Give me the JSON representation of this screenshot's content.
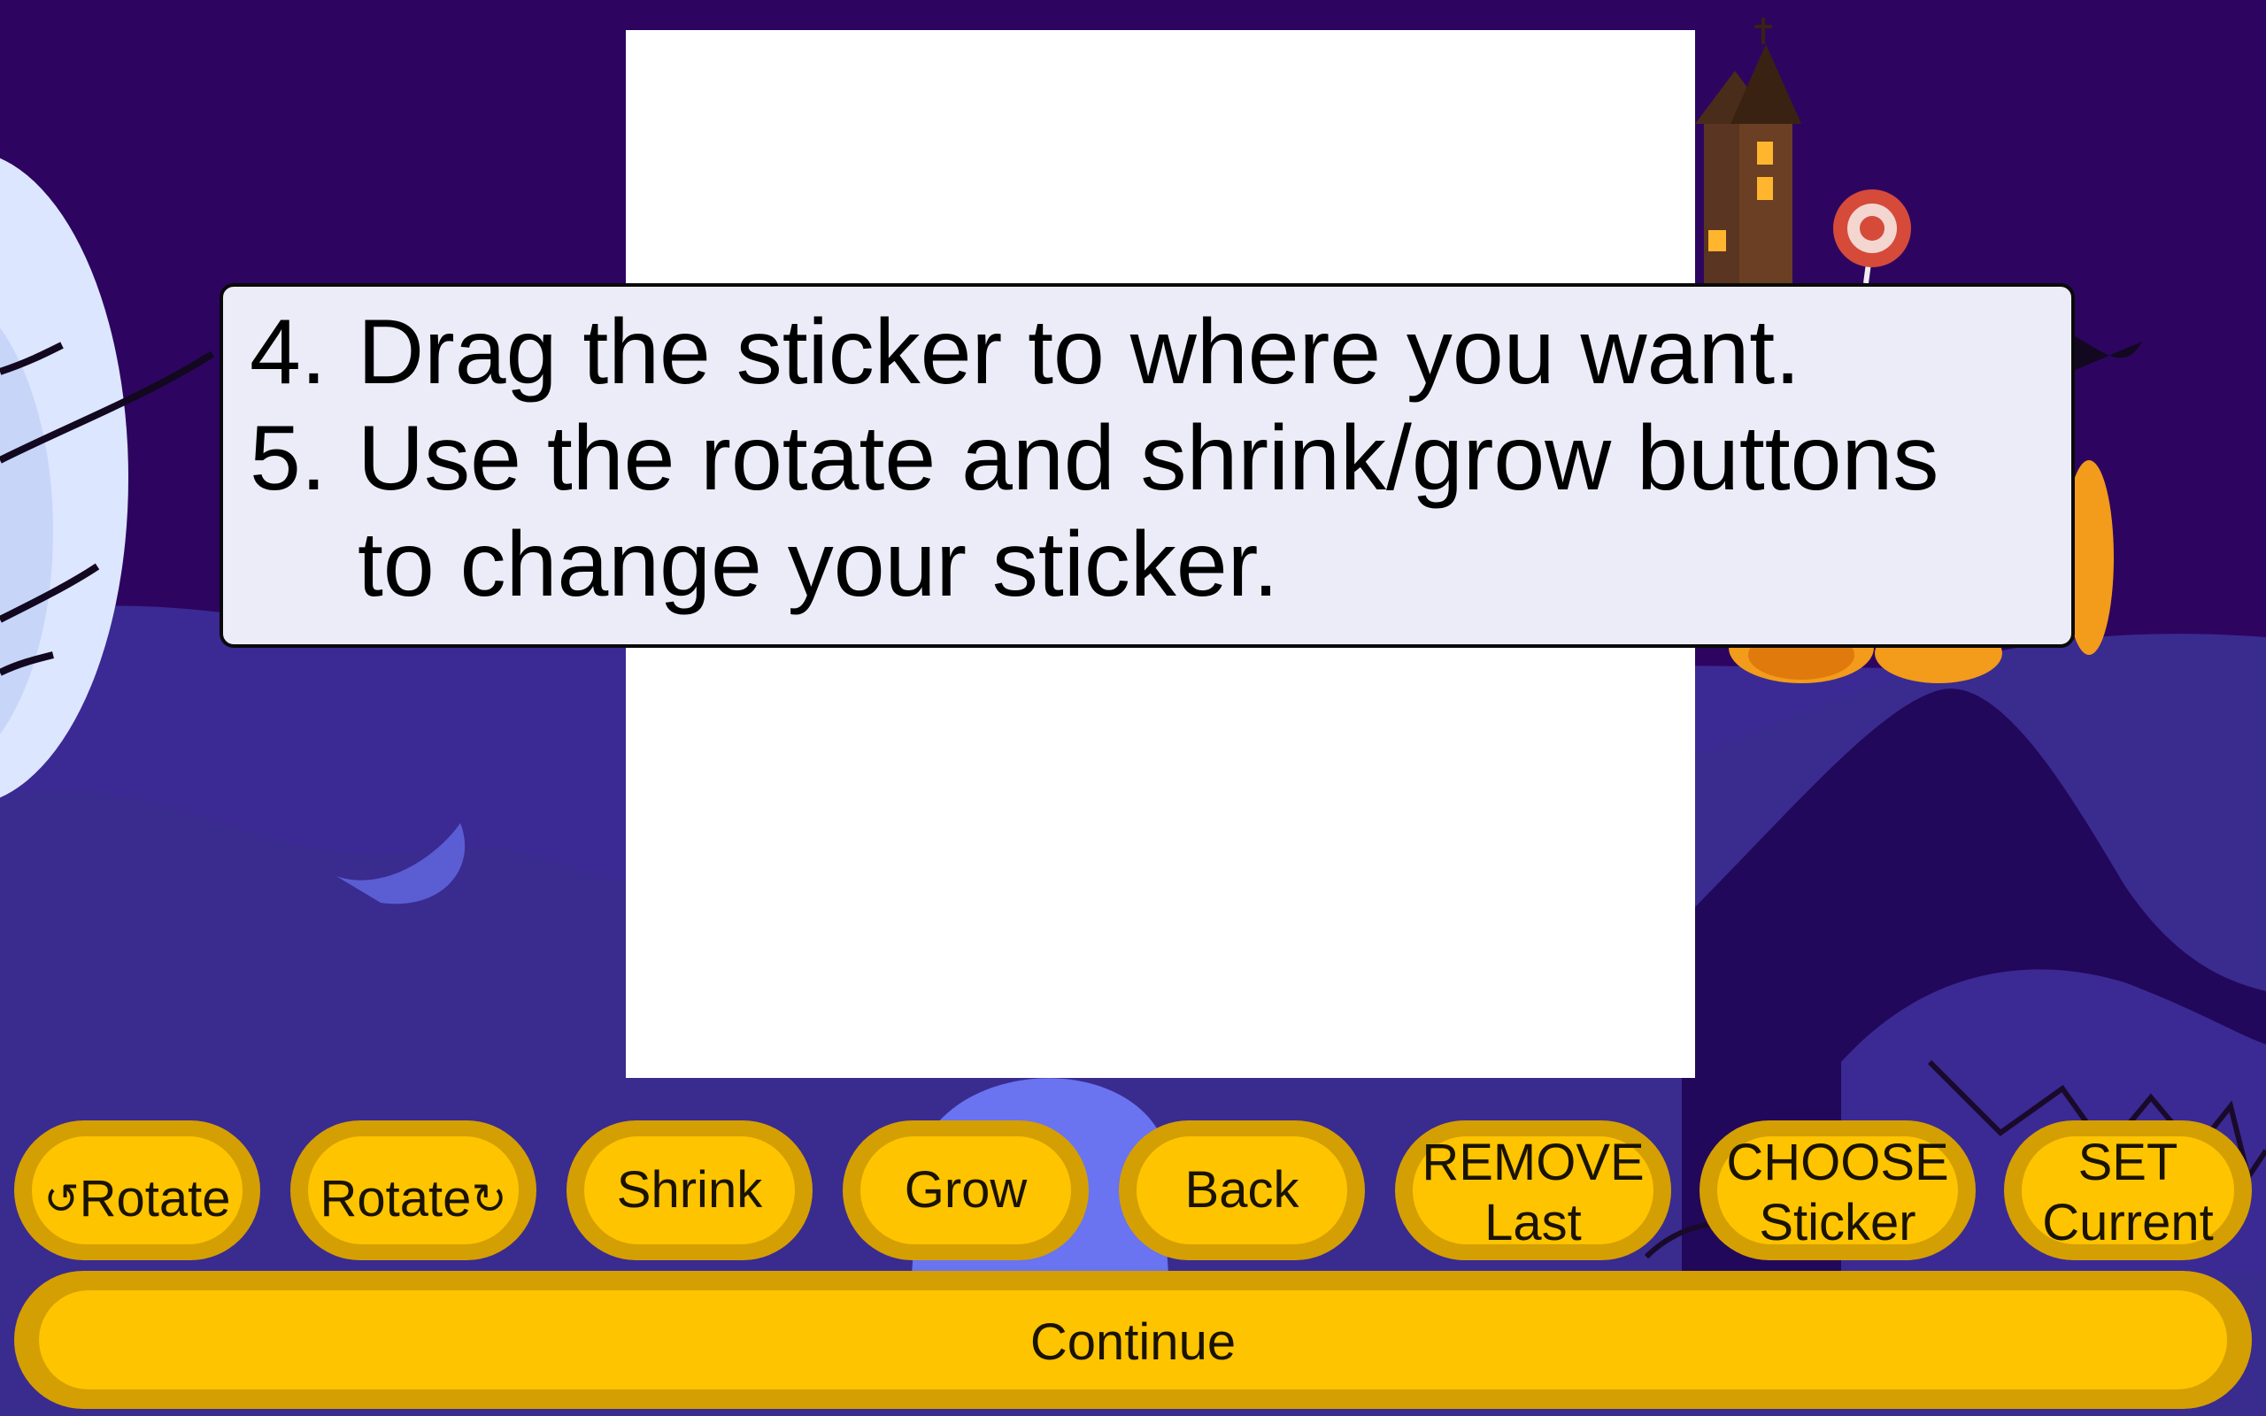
{
  "instructions": {
    "step4_number": "4.",
    "step4_text": "Drag the sticker to where you want.",
    "step5_number": "5.",
    "step5_line1": "Use the rotate and shrink/grow buttons",
    "step5_line2": "to change your sticker."
  },
  "toolbar": {
    "rotate_left": {
      "icon": "↺",
      "label": "Rotate"
    },
    "rotate_right": {
      "icon": "↻",
      "label": "Rotate"
    },
    "shrink": "Shrink",
    "grow": "Grow",
    "back": "Back",
    "remove": {
      "line1": "REMOVE",
      "line2": "Last"
    },
    "choose": {
      "line1": "CHOOSE",
      "line2": "Sticker"
    },
    "set": {
      "line1": "SET",
      "line2": "Current"
    }
  },
  "continue_label": "Continue",
  "colors": {
    "background": "#2d0560",
    "button_face": "#ffc400",
    "button_rim": "#d49f03",
    "instruction_bg": "#ececf8",
    "canvas": "#ffffff"
  }
}
